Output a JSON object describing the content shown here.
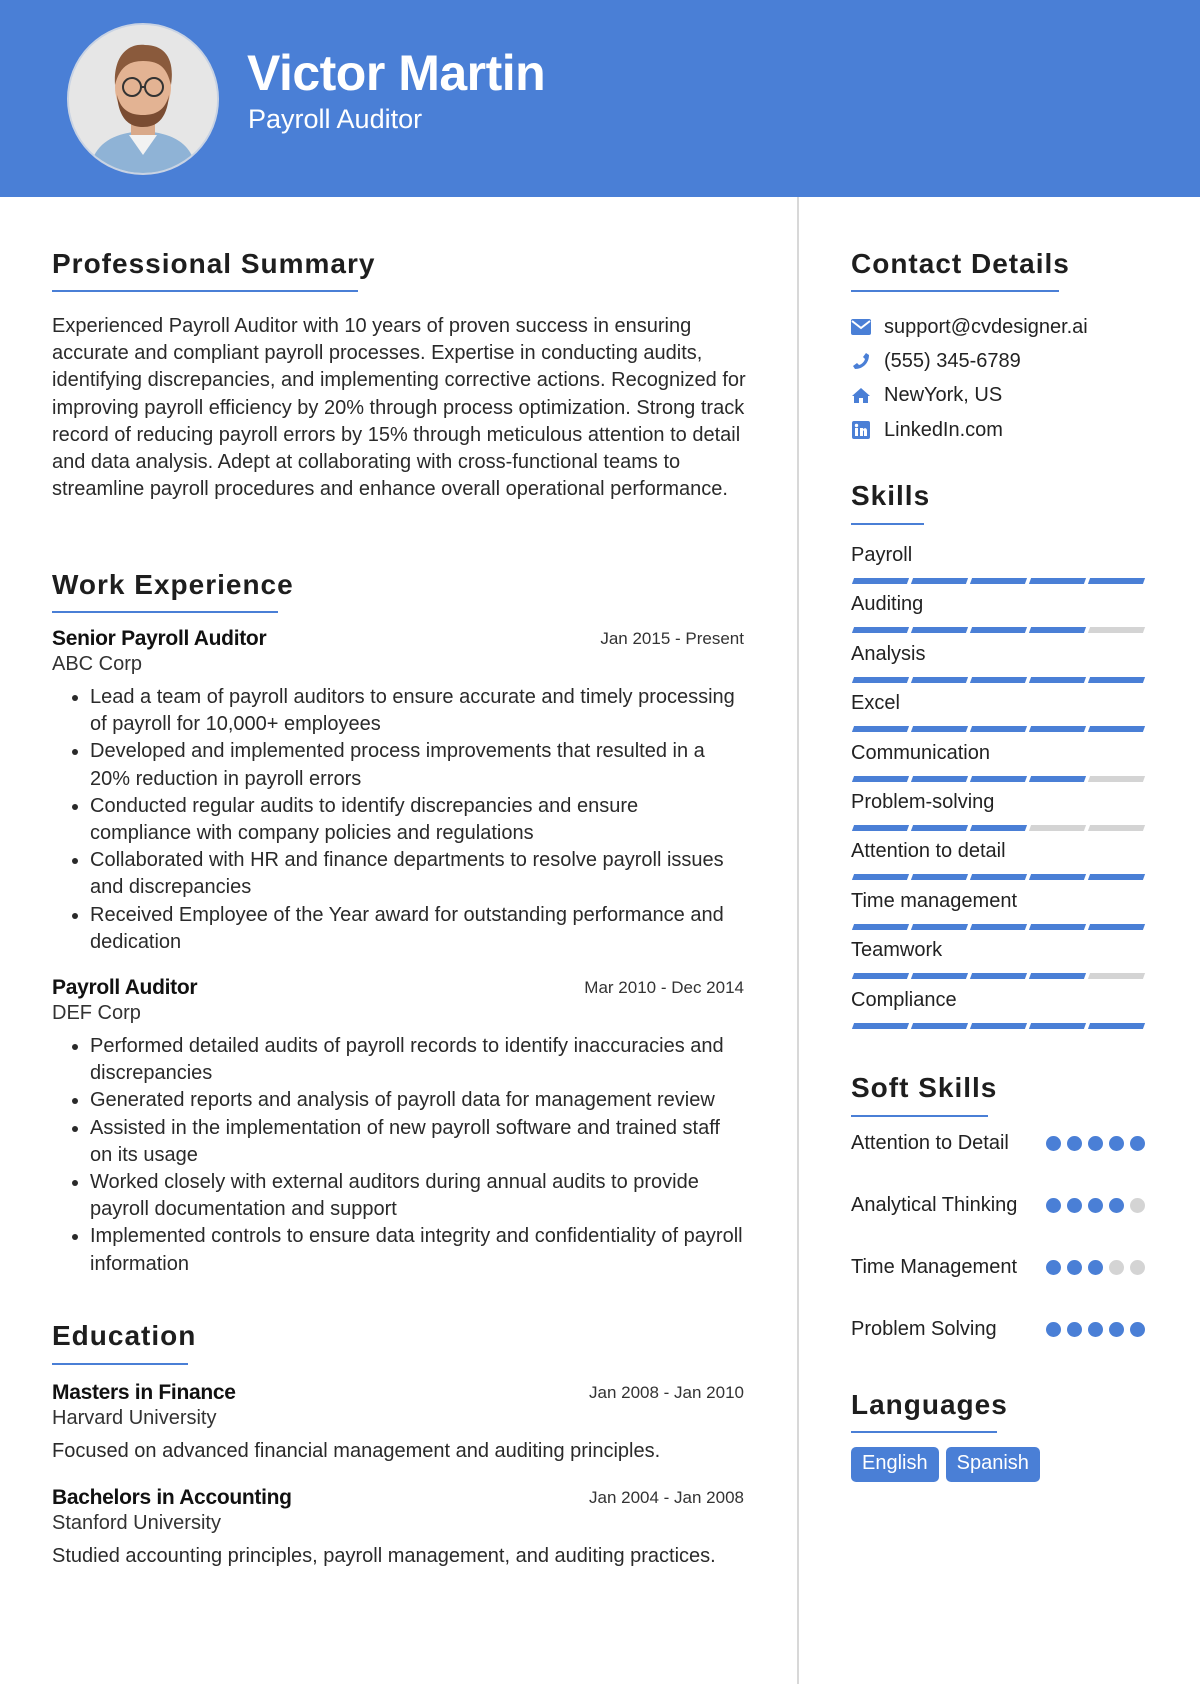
{
  "colors": {
    "accent": "#4a7fd6",
    "bar_empty": "#d4d4d4",
    "text": "#222222"
  },
  "header": {
    "name": "Victor Martin",
    "title": "Payroll Auditor",
    "photo": "profile-photo"
  },
  "summary": {
    "heading": "Professional Summary",
    "text": "Experienced Payroll Auditor with 10 years of proven success in ensuring accurate and compliant payroll processes. Expertise in conducting audits, identifying discrepancies, and implementing corrective actions. Recognized for improving payroll efficiency by 20% through process optimization. Strong track record of reducing payroll errors by 15% through meticulous attention to detail and data analysis. Adept at collaborating with cross-functional teams to streamline payroll procedures and enhance overall operational performance."
  },
  "experience": {
    "heading": "Work Experience",
    "jobs": [
      {
        "role": "Senior Payroll Auditor",
        "company": "ABC Corp",
        "dates": "Jan 2015 - Present",
        "bullets": [
          "Lead a team of payroll auditors to ensure accurate and timely processing of payroll for 10,000+ employees",
          "Developed and implemented process improvements that resulted in a 20% reduction in payroll errors",
          "Conducted regular audits to identify discrepancies and ensure compliance with company policies and regulations",
          "Collaborated with HR and finance departments to resolve payroll issues and discrepancies",
          "Received Employee of the Year award for outstanding performance and dedication"
        ]
      },
      {
        "role": "Payroll Auditor",
        "company": "DEF Corp",
        "dates": "Mar 2010 - Dec 2014",
        "bullets": [
          "Performed detailed audits of payroll records to identify inaccuracies and discrepancies",
          "Generated reports and analysis of payroll data for management review",
          "Assisted in the implementation of new payroll software and trained staff on its usage",
          "Worked closely with external auditors during annual audits to provide payroll documentation and support",
          "Implemented controls to ensure data integrity and confidentiality of payroll information"
        ]
      }
    ]
  },
  "education": {
    "heading": "Education",
    "items": [
      {
        "degree": "Masters in Finance",
        "school": "Harvard University",
        "dates": "Jan 2008 - Jan 2010",
        "desc": "Focused on advanced financial management and auditing principles."
      },
      {
        "degree": "Bachelors in Accounting",
        "school": "Stanford University",
        "dates": "Jan 2004 - Jan 2008",
        "desc": "Studied accounting principles, payroll management, and auditing practices."
      }
    ]
  },
  "contact": {
    "heading": "Contact Details",
    "items": [
      {
        "icon": "envelope-icon",
        "text": "support@cvdesigner.ai"
      },
      {
        "icon": "phone-icon",
        "text": "(555) 345-6789"
      },
      {
        "icon": "home-icon",
        "text": "NewYork, US"
      },
      {
        "icon": "linkedin-icon",
        "text": "LinkedIn.com"
      }
    ]
  },
  "skills": {
    "heading": "Skills",
    "max": 5,
    "items": [
      {
        "label": "Payroll",
        "level": 5
      },
      {
        "label": "Auditing",
        "level": 4
      },
      {
        "label": "Analysis",
        "level": 5
      },
      {
        "label": "Excel",
        "level": 5
      },
      {
        "label": "Communication",
        "level": 4
      },
      {
        "label": "Problem-solving",
        "level": 3
      },
      {
        "label": "Attention to detail",
        "level": 5
      },
      {
        "label": "Time management",
        "level": 5
      },
      {
        "label": "Teamwork",
        "level": 4
      },
      {
        "label": "Compliance",
        "level": 5
      }
    ]
  },
  "soft_skills": {
    "heading": "Soft Skills",
    "max": 5,
    "items": [
      {
        "label": "Attention to Detail",
        "level": 5
      },
      {
        "label": "Analytical Thinking",
        "level": 4
      },
      {
        "label": "Time Management",
        "level": 3
      },
      {
        "label": "Problem Solving",
        "level": 5
      }
    ]
  },
  "languages": {
    "heading": "Languages",
    "items": [
      "English",
      "Spanish"
    ]
  }
}
